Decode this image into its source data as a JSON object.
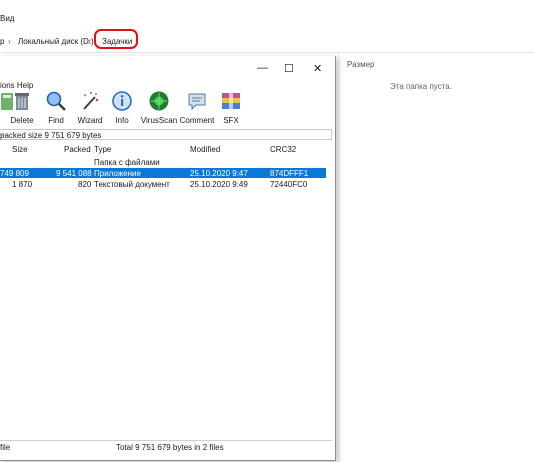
{
  "explorer": {
    "menu_view": "Вид",
    "breadcrumb": {
      "root_partial": "р",
      "sep1": "›",
      "drive": "Локальный диск (D:)",
      "sep2": "›",
      "folder": "Задачки"
    },
    "size_header": "Размер",
    "empty_message": "Эта папка пуста."
  },
  "rar": {
    "controls": {
      "minimize": "—",
      "maximize": "☐",
      "close": "✕"
    },
    "menu": {
      "options_help": "ions  Help"
    },
    "toolbar": [
      {
        "label": "",
        "icon": "folder-icon"
      },
      {
        "label": "Delete",
        "icon": "trash-icon"
      },
      {
        "label": "Find",
        "icon": "magnifier-icon"
      },
      {
        "label": "Wizard",
        "icon": "wand-icon"
      },
      {
        "label": "Info",
        "icon": "info-icon"
      },
      {
        "label": "VirusScan",
        "icon": "virus-icon"
      },
      {
        "label": "Comment",
        "icon": "comment-icon"
      },
      {
        "label": "SFX",
        "icon": "sfx-icon"
      }
    ],
    "pathbar_text": "packed size 9 751 679 bytes",
    "columns": {
      "size": "Size",
      "packed": "Packed",
      "type": "Type",
      "modified": "Modified",
      "crc": "CRC32"
    },
    "rows": [
      {
        "size": "",
        "packed": "",
        "type": "Папка с файлами",
        "modified": "",
        "crc": ""
      },
      {
        "size": "749 809",
        "packed": "9 541 088",
        "type": "Приложение",
        "modified": "25.10.2020 9:47",
        "crc": "874DFFF1"
      },
      {
        "size": "1 870",
        "packed": "820",
        "type": "Текстовый документ",
        "modified": "25.10.2020 9:49",
        "crc": "72440FC0"
      }
    ],
    "status": {
      "left": "file",
      "center": "Total 9 751 679 bytes in 2 files"
    },
    "colors": {
      "selection": "#0a78d7",
      "highlight_ring": "#e01010"
    }
  }
}
